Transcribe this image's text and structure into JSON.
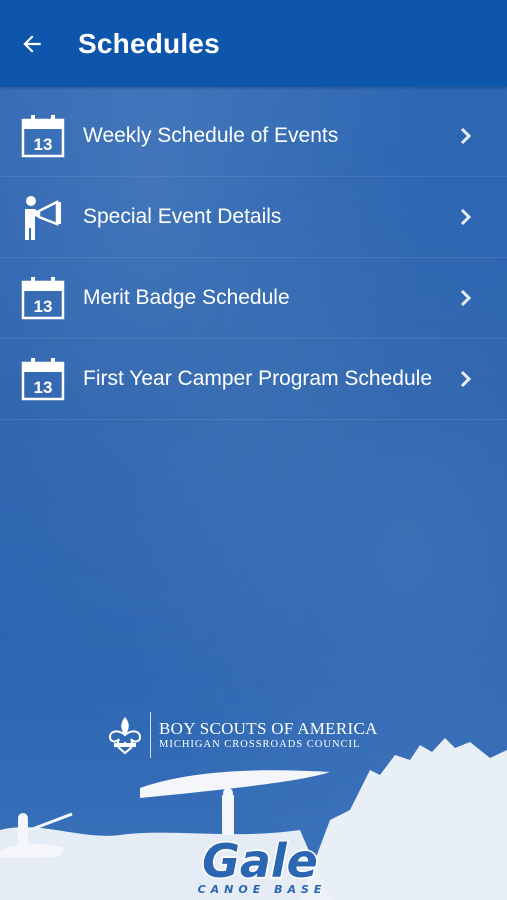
{
  "header": {
    "title": "Schedules",
    "back_icon": "arrow-left-icon"
  },
  "items": [
    {
      "label": "Weekly Schedule of Events",
      "icon": "calendar-icon",
      "icon_text": "13"
    },
    {
      "label": "Special Event Details",
      "icon": "megaphone-person-icon",
      "icon_text": ""
    },
    {
      "label": "Merit Badge Schedule",
      "icon": "calendar-icon",
      "icon_text": "13"
    },
    {
      "label": "First Year Camper Program Schedule",
      "icon": "calendar-icon",
      "icon_text": "13"
    }
  ],
  "footer": {
    "org_line1": "BOY SCOUTS OF AMERICA",
    "org_line2": "MICHIGAN CROSSROADS COUNCIL",
    "logo_text": "Gale",
    "logo_sub": "CANOE BASE"
  },
  "colors": {
    "header_bg": "#0d56ab",
    "page_bg": "#2b64b0",
    "text": "#ffffff"
  }
}
